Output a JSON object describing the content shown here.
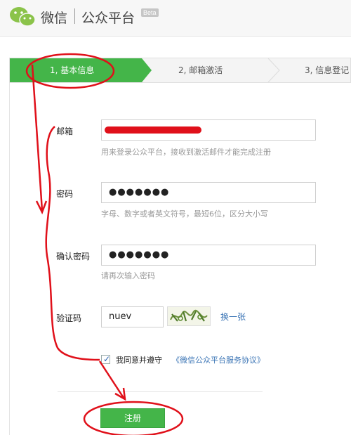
{
  "header": {
    "brand": "微信",
    "product": "公众平台",
    "badge": "Beta"
  },
  "steps": [
    {
      "label": "1, 基本信息",
      "active": true
    },
    {
      "label": "2, 邮箱激活",
      "active": false
    },
    {
      "label": "3, 信息登记",
      "active": false
    }
  ],
  "form": {
    "email": {
      "label": "邮箱",
      "hint": "用来登录公众平台，接收到激活邮件才能完成注册"
    },
    "password": {
      "label": "密码",
      "value": "●●●●●●●",
      "hint": "字母、数字或者英文符号，最短6位，区分大小写"
    },
    "confirm": {
      "label": "确认密码",
      "value": "●●●●●●●",
      "hint": "请再次输入密码"
    },
    "captcha": {
      "label": "验证码",
      "value": "nuev",
      "refresh": "换一张"
    },
    "agreement": {
      "text": "我同意并遵守",
      "link": "《微信公众平台服务协议》",
      "checked": true
    },
    "submit_label": "注册"
  },
  "colors": {
    "accent_green": "#44b549",
    "annotation_red": "#e0101a",
    "link_blue": "#3a74b5"
  }
}
